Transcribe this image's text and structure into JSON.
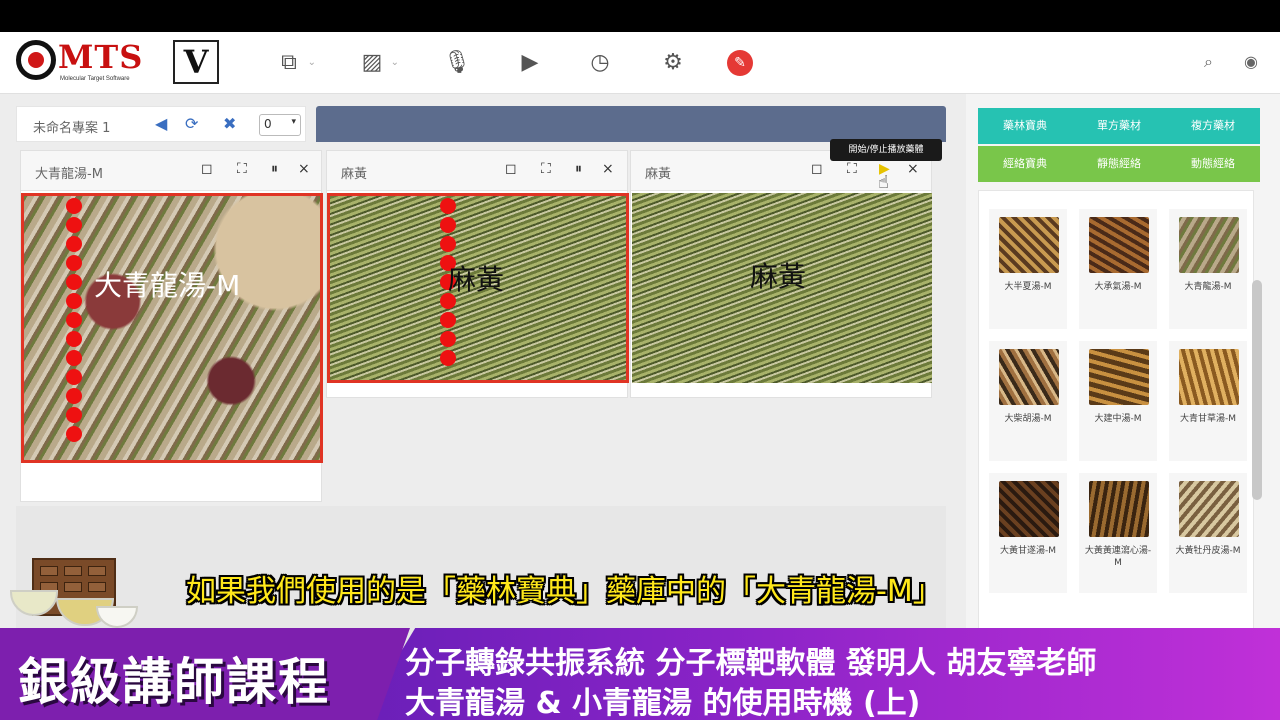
{
  "header": {
    "logo_text": "MTS",
    "logo_sub": "Molecular Target Software",
    "mode_badge": "V",
    "tools": [
      {
        "icon": "copy-icon",
        "glyph": "⧉"
      },
      {
        "icon": "image-icon",
        "glyph": "▨"
      },
      {
        "icon": "microphone-icon",
        "glyph": "🎙"
      },
      {
        "icon": "play-icon",
        "glyph": "▶"
      },
      {
        "icon": "clock-icon",
        "glyph": "◷"
      },
      {
        "icon": "gear-icon",
        "glyph": "⚙"
      },
      {
        "icon": "wrench-icon",
        "glyph": "🔧"
      }
    ],
    "search_glyph": "⌕",
    "eye_glyph": "◉"
  },
  "project": {
    "name": "未命名專案 1",
    "volume_glyph": "◀",
    "refresh_glyph": "⟳",
    "close_glyph": "✖",
    "select_value": "0"
  },
  "panels": [
    {
      "title": "大青龍湯-M",
      "overlay_text": "大青龍湯-M",
      "active": true
    },
    {
      "title": "麻黃",
      "overlay_text": "麻黃",
      "active": true
    },
    {
      "title": "麻黃",
      "overlay_text": "麻黃",
      "active": false
    }
  ],
  "panel_controls": {
    "square": "◻",
    "fullscreen": "⛶",
    "pause": "⏸",
    "close": "×"
  },
  "tooltip": "開始/停止播放藥體",
  "sidebar": {
    "row1": [
      "藥林寶典",
      "單方藥材",
      "複方藥材"
    ],
    "row2": [
      "經絡寶典",
      "靜態經絡",
      "動態經絡"
    ],
    "items": [
      {
        "label": "大半夏湯-M"
      },
      {
        "label": "大承氣湯-M"
      },
      {
        "label": "大青龍湯-M"
      },
      {
        "label": "大柴胡湯-M"
      },
      {
        "label": "大建中湯-M"
      },
      {
        "label": "大青甘草湯-M"
      },
      {
        "label": "大黃甘遂湯-M"
      },
      {
        "label": "大黃黃連瀉心湯-M"
      },
      {
        "label": "大黃牡丹皮湯-M"
      }
    ]
  },
  "subtitle": "如果我們使用的是「藥林寶典」藥庫中的「大青龍湯-M」",
  "banner": {
    "title": "銀級講師課程",
    "line1": "分子轉錄共振系統 分子標靶軟體 發明人 胡友寧老師",
    "line2": "大青龍湯 & 小青龍湯 的使用時機 (上)"
  },
  "colors": {
    "accent_red": "#e03424",
    "teal": "#26c2b2",
    "green": "#79c64a",
    "purple": "#7d1fae"
  }
}
